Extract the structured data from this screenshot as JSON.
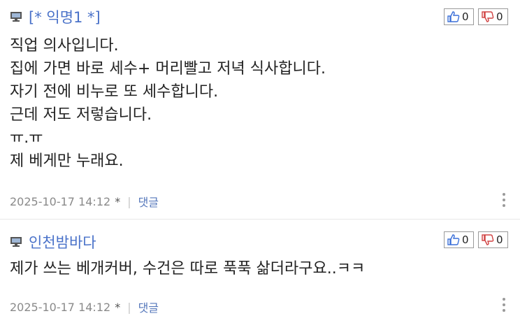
{
  "comments": [
    {
      "author": "[* 익명1 *]",
      "lines": [
        "직업 의사입니다.",
        "집에 가면 바로 세수+ 머리빨고 저녁 식사합니다.",
        "자기 전에 비누로 또 세수합니다.",
        "근데 저도 저렇습니다.",
        "ㅠ.ㅠ",
        "제 베게만 누래요."
      ],
      "likes": "0",
      "dislikes": "0",
      "date": "2025-10-17 14:12",
      "star": "*",
      "separator": "|",
      "reply_label": "댓글"
    },
    {
      "author": "인천밤바다",
      "lines": [
        "제가 쓰는 베개커버, 수건은 따로 푹푹 삶더라구요..ㅋㅋ"
      ],
      "likes": "0",
      "dislikes": "0",
      "date": "2025-10-17 14:12",
      "star": "*",
      "separator": "|",
      "reply_label": "댓글"
    }
  ],
  "colors": {
    "author": "#4a72c9",
    "like_icon": "#3a6fd8",
    "dislike_icon": "#d04040",
    "meta_text": "#8a8a8a"
  },
  "icons": {
    "author_icon": "pc-monitor-icon",
    "like_icon": "thumbs-up-icon",
    "dislike_icon": "thumbs-down-icon",
    "more_icon": "vertical-ellipsis-icon"
  }
}
